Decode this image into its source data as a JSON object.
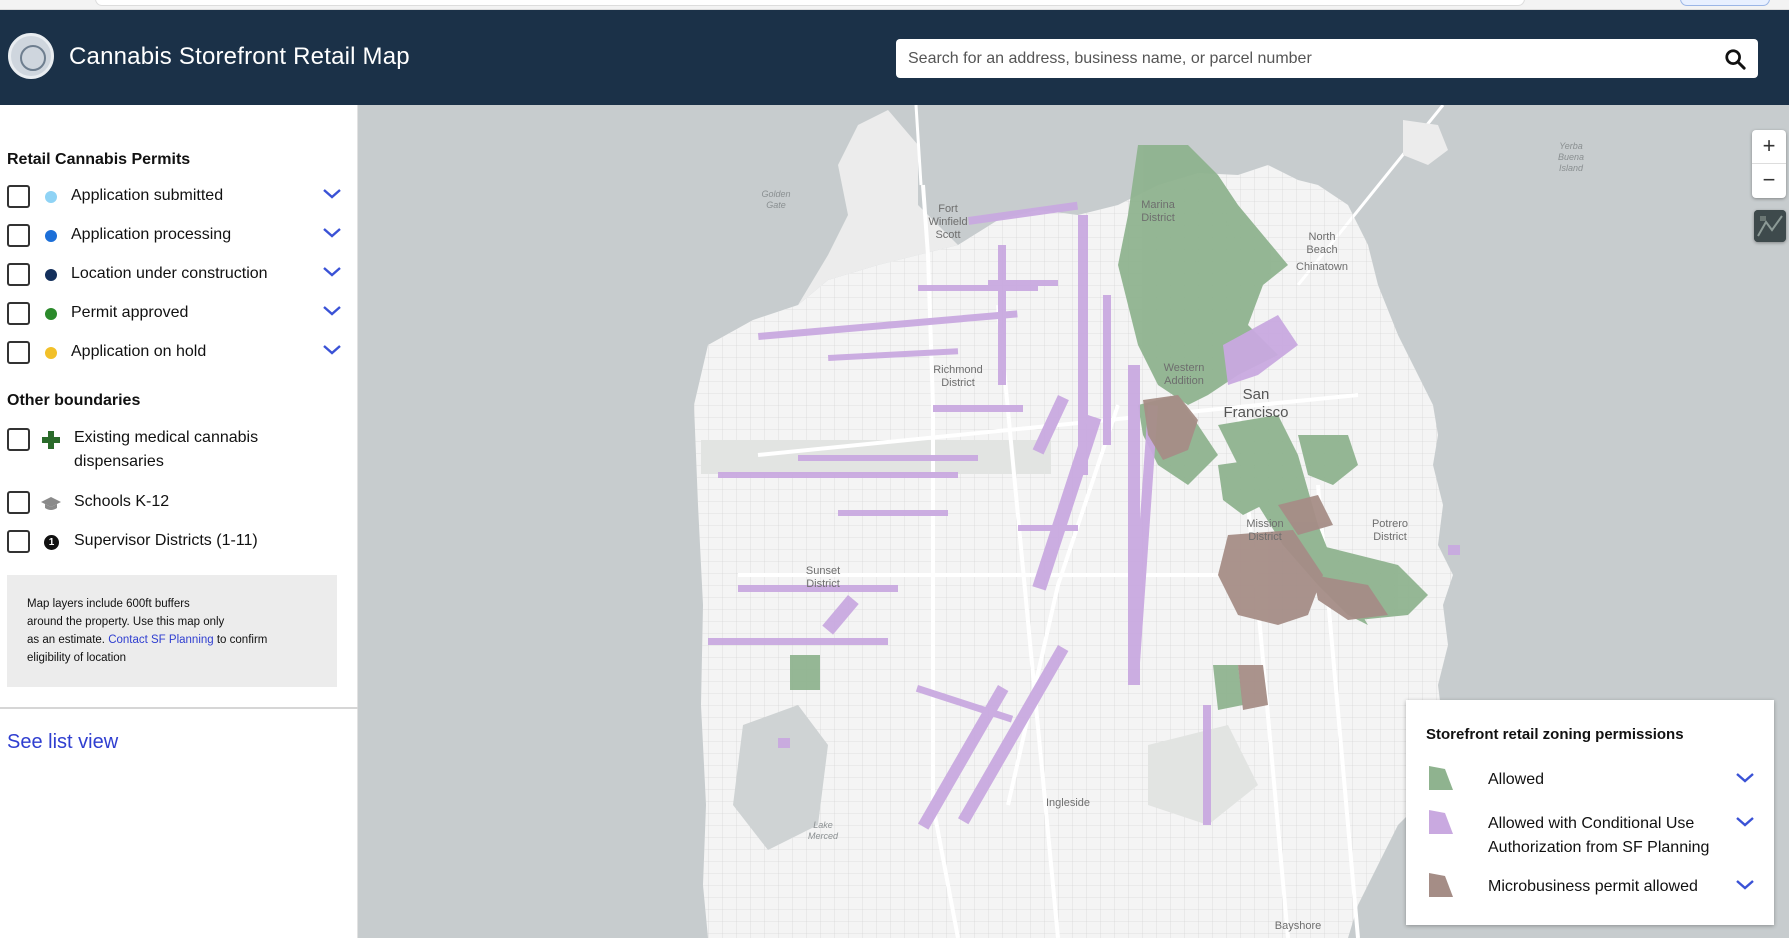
{
  "header": {
    "title": "Cannabis Storefront Retail Map",
    "search_placeholder": "Search for an address, business name, or parcel number"
  },
  "sidebar": {
    "permits_title": "Retail Cannabis Permits",
    "permits": [
      {
        "label": "Application submitted",
        "color": "#8fd3f5"
      },
      {
        "label": "Application processing",
        "color": "#1c6fd8"
      },
      {
        "label": "Location under construction",
        "color": "#14305c"
      },
      {
        "label": "Permit approved",
        "color": "#2b8a2b"
      },
      {
        "label": "Application on hold",
        "color": "#f2c029"
      }
    ],
    "boundaries_title": "Other boundaries",
    "boundaries": [
      {
        "label_line1": "Existing medical cannabis",
        "label_line2": "dispensaries",
        "icon": "cross-icon",
        "color": "#2b6b2b"
      },
      {
        "label": "Schools K-12",
        "icon": "graduation-cap-icon"
      },
      {
        "label": "Supervisor Districts (1-11)",
        "icon": "district-number-icon",
        "icon_text": "1"
      }
    ],
    "note": {
      "line1": "Map layers include 600ft buffers",
      "line2": "around the property. Use this map only",
      "line3_prefix": "as an estimate. ",
      "link": "Contact SF Planning",
      "line3_suffix": " to confirm",
      "line4": "eligibility of location"
    },
    "list_view_link": "See list view"
  },
  "map": {
    "labels": {
      "golden_gate": [
        "Golden",
        "Gate"
      ],
      "fort_winfield": [
        "Fort",
        "Winfield",
        "Scott"
      ],
      "marina": [
        "Marina",
        "District"
      ],
      "north_beach": [
        "North",
        "Beach"
      ],
      "chinatown": "Chinatown",
      "yerba_buena": [
        "Yerba",
        "Buena",
        "Island"
      ],
      "richmond": [
        "Richmond",
        "District"
      ],
      "western_addition": [
        "Western",
        "Addition"
      ],
      "san_francisco": [
        "San",
        "Francisco"
      ],
      "mission": [
        "Mission",
        "District"
      ],
      "potrero": [
        "Potrero",
        "District"
      ],
      "sunset": [
        "Sunset",
        "District"
      ],
      "ingleside": "Ingleside",
      "lake_merced": [
        "Lake",
        "Merced"
      ],
      "bayshore": "Bayshore"
    },
    "zoom_in": "+",
    "zoom_out": "−",
    "colors": {
      "water": "#c7ccce",
      "land": "#f4f4f4",
      "park": "#e2e4e2",
      "allowed": "#8fb38f",
      "conditional": "#c9a9e0",
      "microbusiness": "#a58d86"
    }
  },
  "legend": {
    "title": "Storefront retail zoning permissions",
    "items": [
      {
        "label": "Allowed",
        "color": "#8fb38f"
      },
      {
        "label_line1": "Allowed with Conditional Use",
        "label_line2": "Authorization from SF Planning",
        "color": "#c9a9e0"
      },
      {
        "label": "Microbusiness permit allowed",
        "color": "#a58d86"
      }
    ]
  }
}
